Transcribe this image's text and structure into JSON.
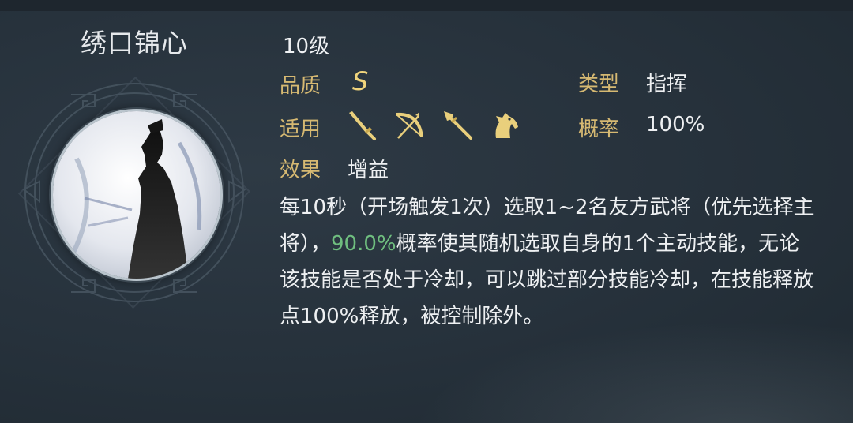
{
  "skill": {
    "name": "绣口锦心",
    "level": "10级",
    "quality_label": "品质",
    "quality_value": "S",
    "type_label": "类型",
    "type_value": "指挥",
    "applicable_label": "适用",
    "applicable_troops": [
      "sword-icon",
      "bow-icon",
      "spear-icon",
      "horse-icon"
    ],
    "chance_label": "概率",
    "chance_value": "100%",
    "effect_label": "效果",
    "effect_value": "增益",
    "description": {
      "part1": "每10秒（开场触发1次）选取1~2名友方武将（优先选择主将），",
      "highlight": "90.0%",
      "part2": "概率使其随机选取自身的1个主动技能，无论该技能是否处于冷却，可以跳过部分技能冷却，在技能释放点100%释放，被控制除外。"
    }
  },
  "colors": {
    "label_gold": "#d6b972",
    "grade_gold": "#f0d47c",
    "highlight_green": "#6fbe7f",
    "background": "#26313b"
  }
}
